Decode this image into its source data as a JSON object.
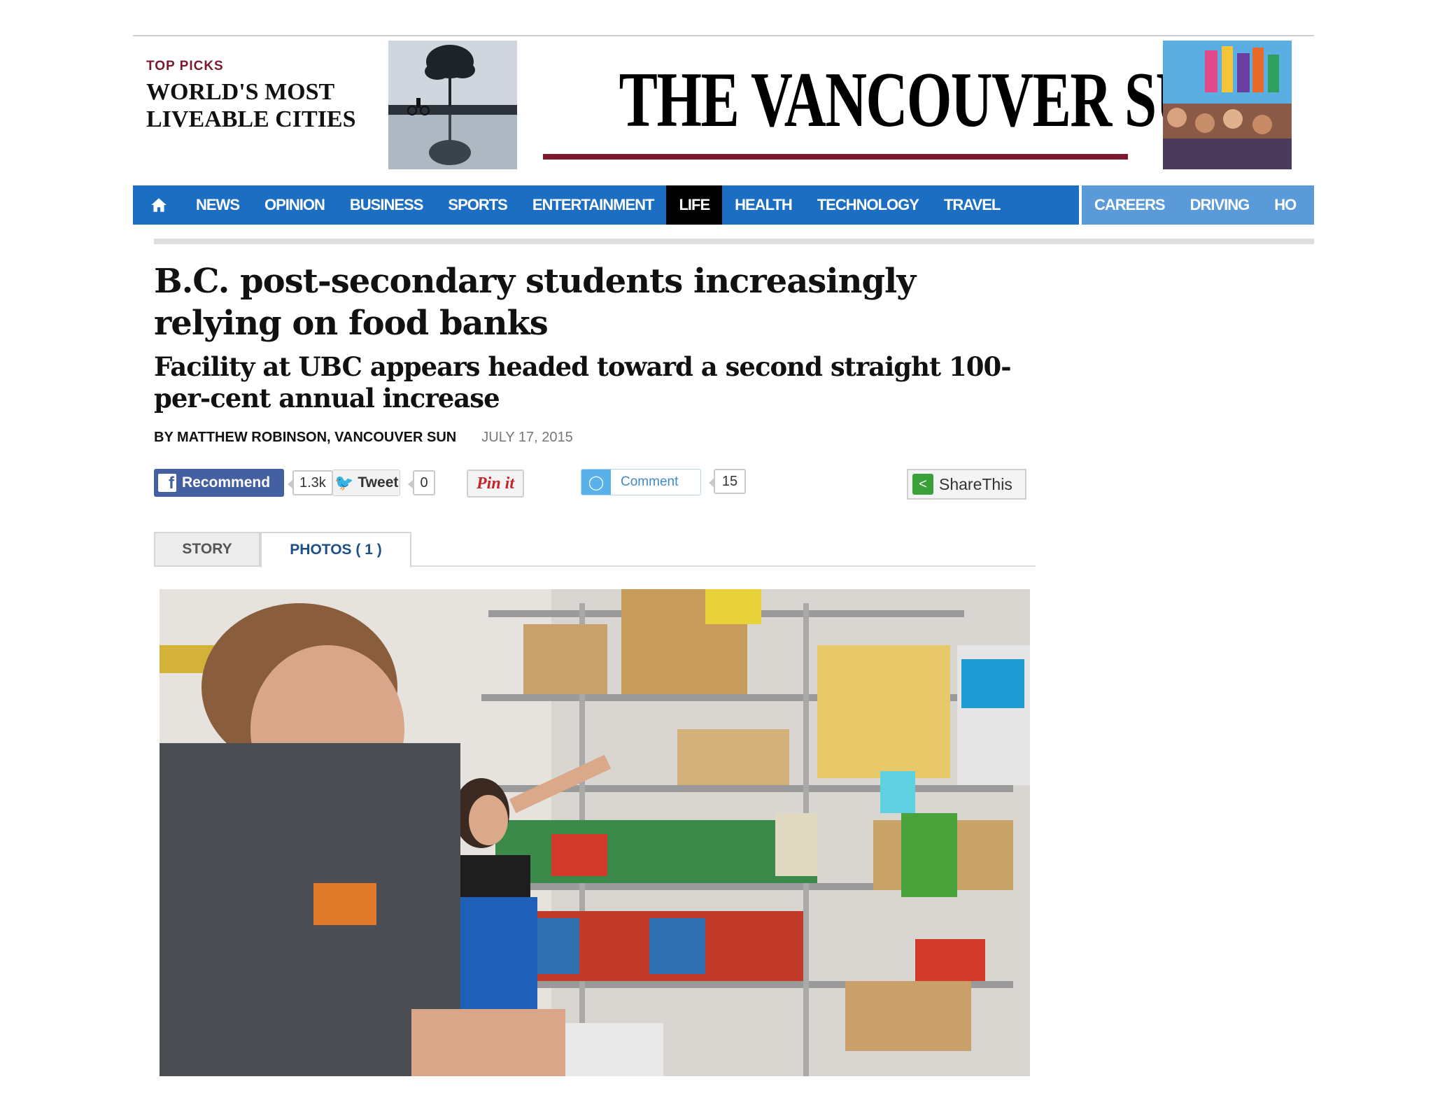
{
  "top_picks": {
    "kicker": "TOP PICKS",
    "promo": "World's Most Liveable Cities"
  },
  "masthead": {
    "logo_text": "The Vancouver Sun",
    "brand_color": "#7a1a2e"
  },
  "nav": {
    "home_icon": "home-icon",
    "items": [
      "News",
      "Opinion",
      "Business",
      "Sports",
      "Entertainment",
      "Life",
      "Health",
      "Technology",
      "Travel"
    ],
    "active": "Life",
    "secondary": [
      "Careers",
      "Driving",
      "Ho"
    ],
    "colors": {
      "primary": "#1b6ec2",
      "secondary": "#5a9ad8",
      "active": "#000000"
    }
  },
  "article": {
    "headline": "B.C. post-secondary students increasingly relying on food banks",
    "subhead": "Facility at UBC appears headed toward a second straight 100-per-cent annual increase",
    "byline": "BY MATTHEW ROBINSON, VANCOUVER SUN",
    "date": "JULY 17, 2015"
  },
  "share": {
    "facebook_label": "Recommend",
    "facebook_count": "1.3k",
    "tweet_label": "Tweet",
    "tweet_count": "0",
    "pin_label": "Pin it",
    "comment_label": "Comment",
    "comment_count": "15",
    "sharethis_label": "ShareThis"
  },
  "tabs": {
    "story": "STORY",
    "photos": "PHOTOS ( 1 )",
    "active": "photos"
  }
}
